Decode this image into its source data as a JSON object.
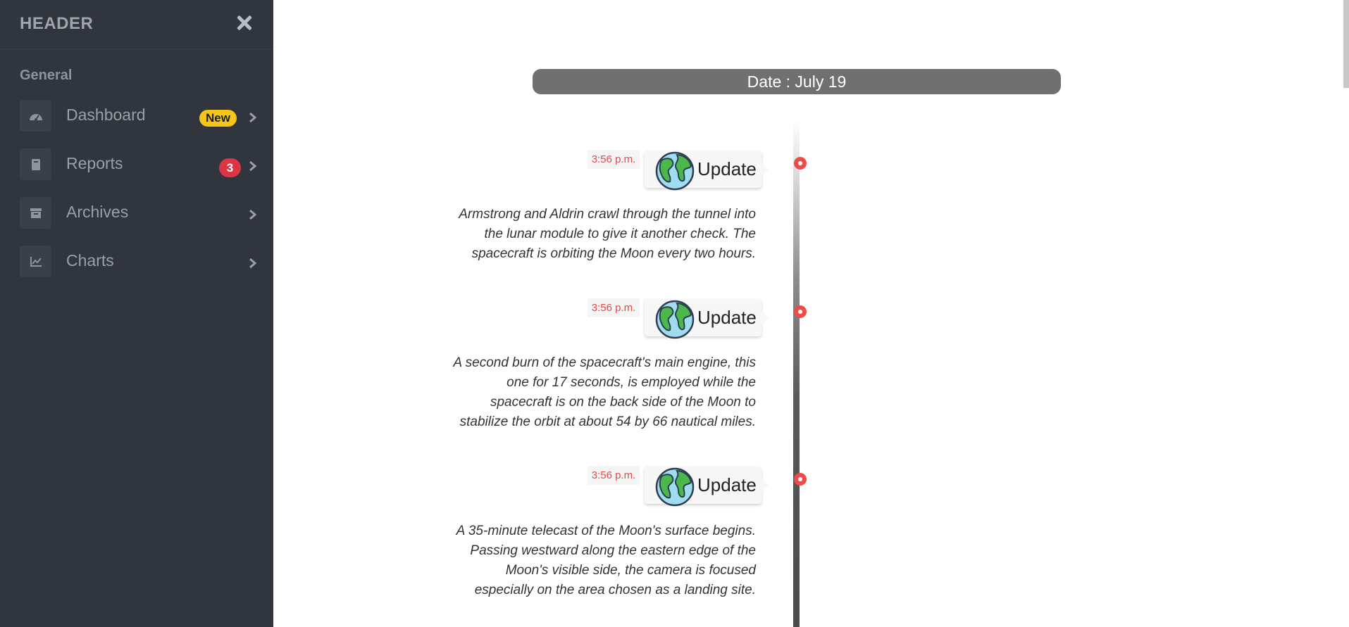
{
  "sidebar": {
    "title": "HEADER",
    "section": "General",
    "items": [
      {
        "label": "Dashboard",
        "badge": "New",
        "icon": "dashboard-gauge-icon"
      },
      {
        "label": "Reports",
        "badge": "3",
        "icon": "book-icon"
      },
      {
        "label": "Archives",
        "badge": "",
        "icon": "archive-box-icon"
      },
      {
        "label": "Charts",
        "badge": "",
        "icon": "line-chart-icon"
      }
    ]
  },
  "main": {
    "date_label": "Date : July 19",
    "events": [
      {
        "time": "3:56 p.m.",
        "title": "Update",
        "description": "Armstrong and Aldrin crawl through the tunnel into the lunar module to give it another check. The spacecraft is orbiting the Moon every two hours."
      },
      {
        "time": "3:56 p.m.",
        "title": "Update",
        "description": "A second burn of the spacecraft's main engine, this one for 17 seconds, is employed while the spacecraft is on the back side of the Moon to stabilize the orbit at about 54 by 66 nautical miles."
      },
      {
        "time": "3:56 p.m.",
        "title": "Update",
        "description": "A 35-minute telecast of the Moon's surface begins. Passing westward along the eastern edge of the Moon's visible side, the camera is focused especially on the area chosen as a landing site."
      }
    ]
  },
  "colors": {
    "sidebar_bg": "#31353d",
    "badge_new": "#f5c518",
    "badge_count": "#dc3545",
    "timeline_dot": "#f04b4b",
    "date_pill": "#707070"
  }
}
